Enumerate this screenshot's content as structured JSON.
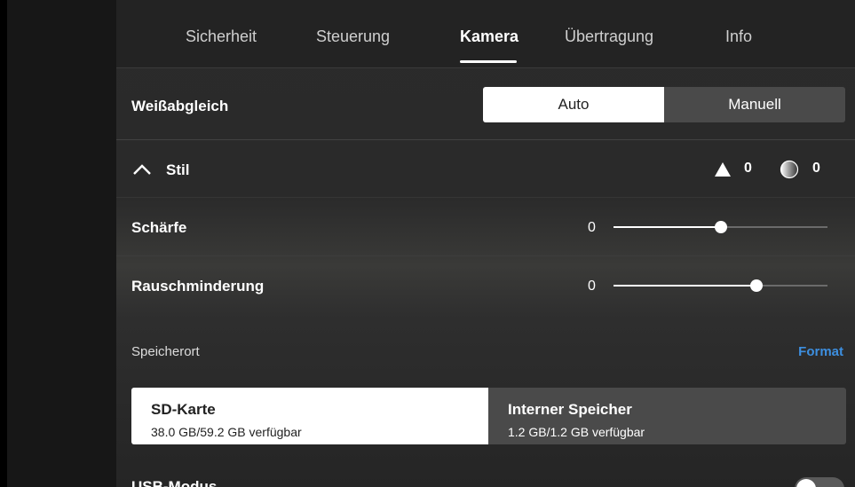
{
  "tabs": [
    {
      "label": "Sicherheit",
      "active": false
    },
    {
      "label": "Steuerung",
      "active": false
    },
    {
      "label": "Kamera",
      "active": true
    },
    {
      "label": "Übertragung",
      "active": false
    },
    {
      "label": "Info",
      "active": false
    }
  ],
  "white_balance": {
    "label": "Weißabgleich",
    "options": [
      "Auto",
      "Manuell"
    ],
    "selected": "Auto"
  },
  "style": {
    "label": "Stil",
    "expanded": true,
    "sharpness_summary": "0",
    "noise_summary": "0",
    "sharpness_icon": "triangle-icon",
    "noise_icon": "circle-gradient-icon"
  },
  "sharpness": {
    "label": "Schärfe",
    "value": "0",
    "fraction": 0.5
  },
  "noise_reduction": {
    "label": "Rauschminderung",
    "value": "0",
    "fraction": 0.67
  },
  "storage": {
    "label": "Speicherort",
    "format_label": "Format",
    "options": [
      {
        "title": "SD-Karte",
        "subtitle": "38.0 GB/59.2 GB verfügbar",
        "selected": true
      },
      {
        "title": "Interner Speicher",
        "subtitle": "1.2 GB/1.2 GB verfügbar",
        "selected": false
      }
    ]
  },
  "usb_mode": {
    "label": "USB-Modus",
    "enabled": false
  },
  "colors": {
    "accent": "#3d8fe0",
    "background": "#2b2b2b"
  }
}
